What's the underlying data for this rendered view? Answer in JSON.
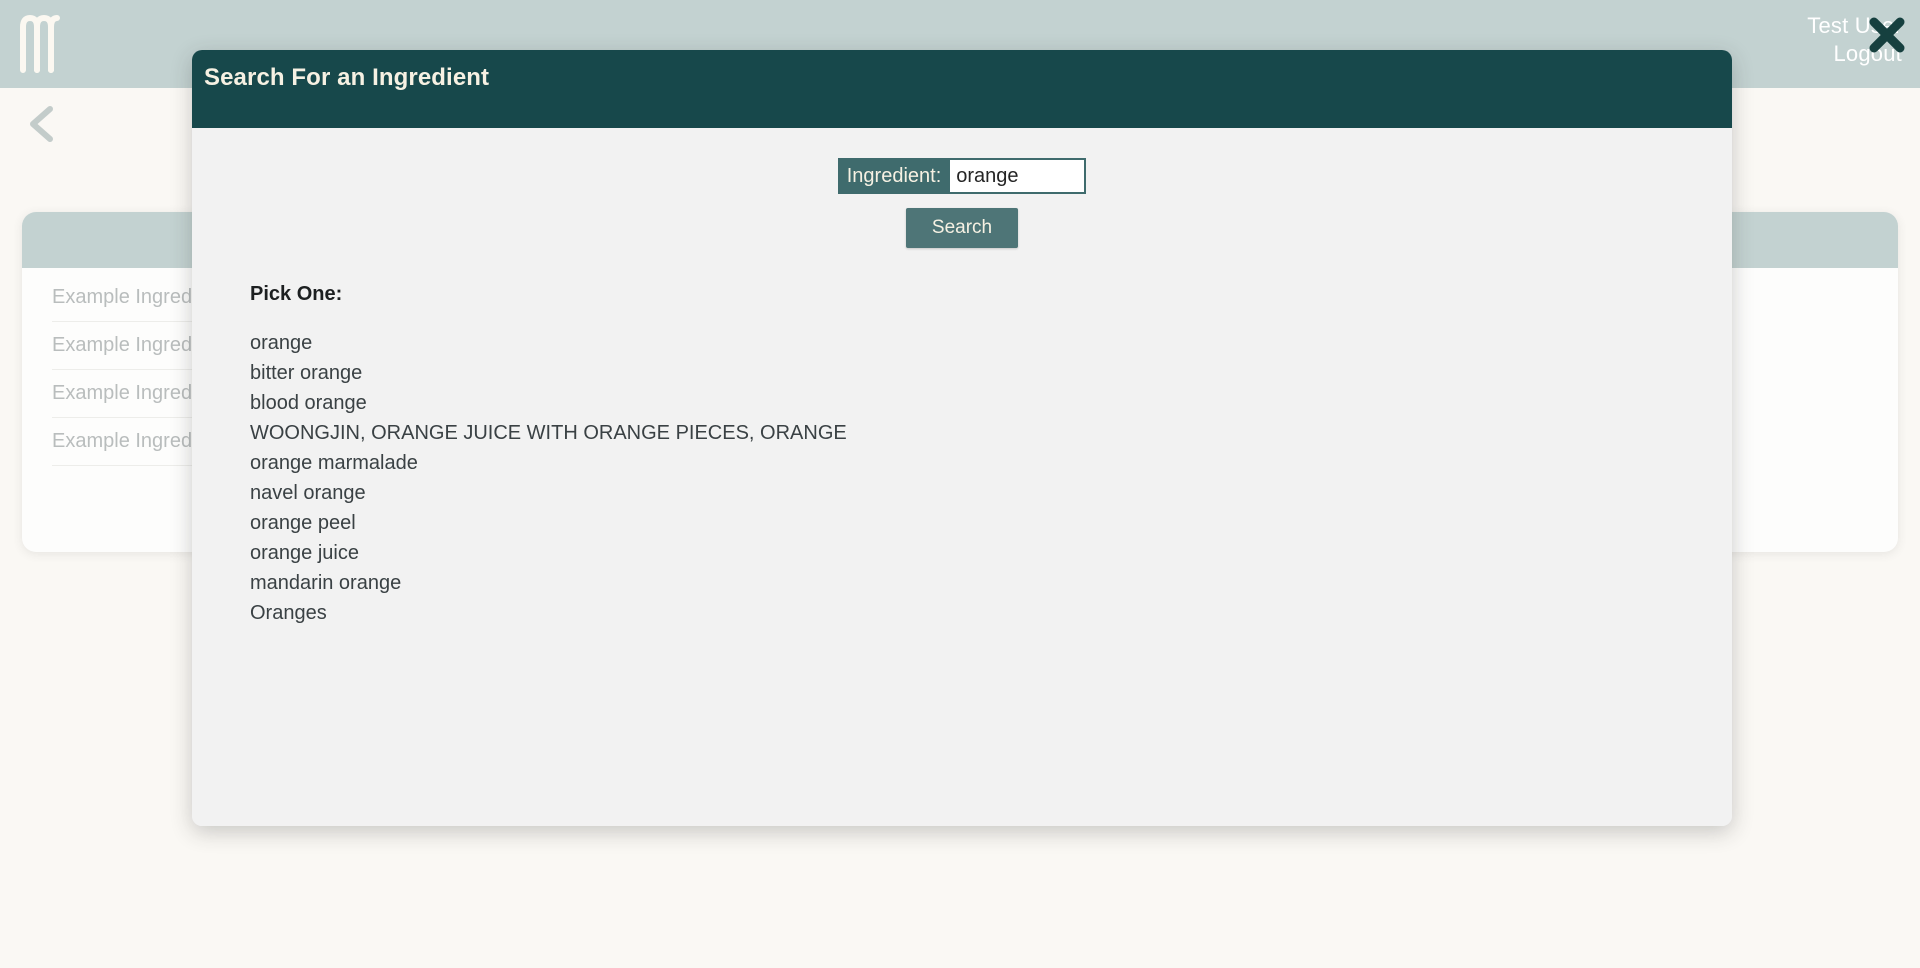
{
  "theme": {
    "header_teal": "#17484B",
    "accent_teal": "#3F6B6D",
    "button_teal": "#4E7577",
    "top_bar": "#C3D2D1",
    "page_bg": "#FAF8F4",
    "modal_bg": "#F2F2F2",
    "cream_text": "#F6F1E3"
  },
  "top_bar": {
    "logo_icon": "m-logo-icon",
    "user_name": "Test User",
    "logout_label": "Logout",
    "close_icon": "close-icon"
  },
  "nav": {
    "back_icon": "chevron-left-icon"
  },
  "background": {
    "left_card": {
      "rows": [
        "Example Ingredient",
        "Example Ingredient",
        "Example Ingredient",
        "Example Ingredient"
      ]
    },
    "right_card": {
      "rows": []
    }
  },
  "modal": {
    "title": "Search For an Ingredient",
    "search": {
      "label": "Ingredient:",
      "value": "orange",
      "placeholder": "",
      "button_label": "Search"
    },
    "results": {
      "heading": "Pick One:",
      "items": [
        "orange",
        "bitter orange",
        "blood orange",
        "WOONGJIN, ORANGE JUICE WITH ORANGE PIECES, ORANGE",
        "orange marmalade",
        "navel orange",
        "orange peel",
        "orange juice",
        "mandarin orange",
        "Oranges"
      ]
    }
  }
}
